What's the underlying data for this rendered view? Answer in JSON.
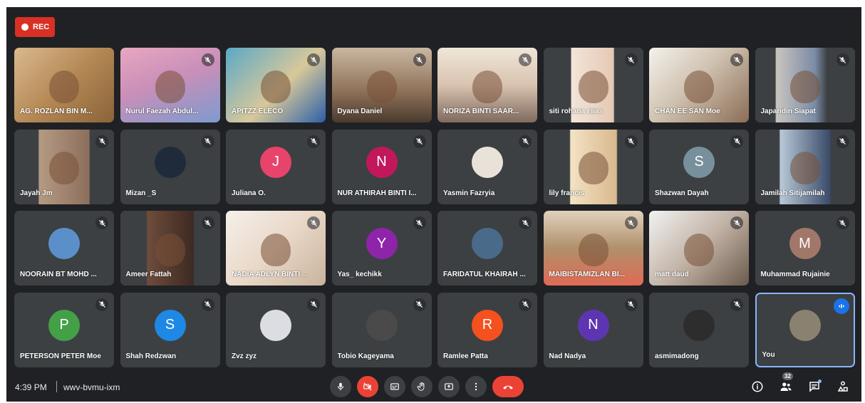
{
  "recording": {
    "label": "REC",
    "color": "#d93025"
  },
  "participants": [
    {
      "name": "AG. ROZLAN BIN M...",
      "type": "video",
      "video": "vid-a",
      "muted": false
    },
    {
      "name": "Nurul Faezah Abdul...",
      "type": "video",
      "video": "vid-b",
      "muted": true
    },
    {
      "name": "APITZZ ELECO",
      "type": "video",
      "video": "vid-c",
      "muted": true
    },
    {
      "name": "Dyana Daniel",
      "type": "video",
      "video": "vid-d",
      "muted": true
    },
    {
      "name": "NORIZA BINTI SAAR...",
      "type": "video",
      "video": "vid-e",
      "muted": true
    },
    {
      "name": "siti rohana elias",
      "type": "video",
      "video": "vid-f",
      "muted": true
    },
    {
      "name": "CHAN EE SAN Moe",
      "type": "video",
      "video": "vid-g",
      "muted": true
    },
    {
      "name": "Japaridin Siapat",
      "type": "video",
      "video": "vid-h",
      "muted": true
    },
    {
      "name": "Jayah Jm",
      "type": "video",
      "video": "vid-i",
      "muted": true
    },
    {
      "name": "Mizan _S",
      "type": "photo",
      "avatar_color": "#1f2b3a",
      "muted": true
    },
    {
      "name": "Juliana O.",
      "type": "letter",
      "letter": "J",
      "avatar_color": "#e8436b",
      "muted": true
    },
    {
      "name": "NUR ATHIRAH BINTI I...",
      "type": "letter",
      "letter": "N",
      "avatar_color": "#c2185b",
      "muted": true
    },
    {
      "name": "Yasmin Fazryia",
      "type": "photo",
      "avatar_color": "#e9e2d8",
      "muted": true
    },
    {
      "name": "lily francis",
      "type": "video",
      "video": "vid-j",
      "muted": true
    },
    {
      "name": "Shazwan Dayah",
      "type": "letter",
      "letter": "S",
      "avatar_color": "#78909c",
      "muted": true
    },
    {
      "name": "Jamilah Sitijamilah",
      "type": "video",
      "video": "vid-k",
      "muted": true
    },
    {
      "name": "NOORAIN BT MOHD ...",
      "type": "photo",
      "avatar_color": "#5b8fc9",
      "muted": true
    },
    {
      "name": "Ameer Fattah",
      "type": "video",
      "video": "vid-l",
      "muted": true
    },
    {
      "name": "NADIA ADLYN BINTI ...",
      "type": "video",
      "video": "vid-m",
      "muted": true
    },
    {
      "name": "Yas_ kechikk",
      "type": "letter",
      "letter": "Y",
      "avatar_color": "#8e24aa",
      "muted": true
    },
    {
      "name": "FARIDATUL KHAIRAH ...",
      "type": "photo",
      "avatar_color": "#4a6a8a",
      "muted": true
    },
    {
      "name": "MAIBISTAMIZLAN BI...",
      "type": "video",
      "video": "vid-n",
      "muted": true
    },
    {
      "name": "matt daud",
      "type": "video",
      "video": "vid-o",
      "muted": true
    },
    {
      "name": "Muhammad Rujainie",
      "type": "letter",
      "letter": "M",
      "avatar_color": "#a1776a",
      "muted": true
    },
    {
      "name": "PETERSON PETER Moe",
      "type": "letter",
      "letter": "P",
      "avatar_color": "#43a047",
      "muted": true
    },
    {
      "name": "Shah Redzwan",
      "type": "letter",
      "letter": "S",
      "avatar_color": "#1e88e5",
      "muted": true
    },
    {
      "name": "Zvz zyz",
      "type": "photo",
      "avatar_color": "#dcdde3",
      "muted": true
    },
    {
      "name": "Tobio Kageyama",
      "type": "photo",
      "avatar_color": "#4a4a4a",
      "muted": true
    },
    {
      "name": "Ramlee Patta",
      "type": "letter",
      "letter": "R",
      "avatar_color": "#f4511e",
      "muted": true
    },
    {
      "name": "Nad Nadya",
      "type": "letter",
      "letter": "N",
      "avatar_color": "#5e35b1",
      "muted": true
    },
    {
      "name": "asmimadong",
      "type": "photo",
      "avatar_color": "#2d2d2d",
      "muted": true
    },
    {
      "name": "You",
      "type": "photo",
      "avatar_color": "#8a8170",
      "muted": false,
      "speaking": true
    }
  ],
  "bottom_bar": {
    "time": "4:39 PM",
    "meeting_code": "wwv-bvmu-ixm",
    "controls": [
      "mic-icon",
      "camera-off-icon",
      "captions-icon",
      "raise-hand-icon",
      "present-icon",
      "more-options-icon",
      "end-call-icon"
    ],
    "people_count": "32",
    "right_icons": [
      "info-icon",
      "people-icon",
      "chat-icon",
      "activities-icon"
    ]
  }
}
